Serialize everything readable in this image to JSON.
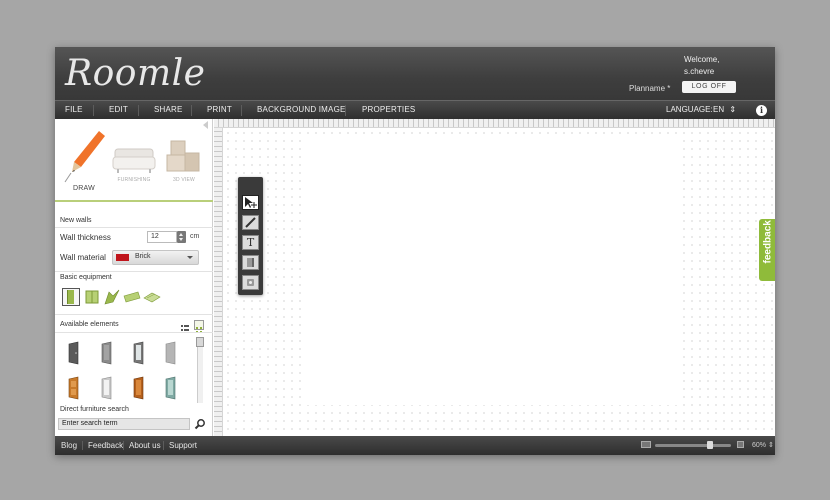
{
  "header": {
    "logo": "Roomle",
    "welcome": "Welcome,",
    "username": "s.chevre",
    "planname_label": "Planname *",
    "logoff_label": "LOG OFF"
  },
  "menu": {
    "items": [
      {
        "label": "FILE"
      },
      {
        "label": "EDIT"
      },
      {
        "label": "SHARE"
      },
      {
        "label": "PRINT"
      },
      {
        "label": "BACKGROUND IMAGE"
      },
      {
        "label": "PROPERTIES"
      }
    ],
    "language_label": "LANGUAGE:",
    "language_value": "EN",
    "info_icon": "i"
  },
  "panel": {
    "tabs": [
      {
        "label": "DRAW",
        "icon": "pencil-icon",
        "active": true
      },
      {
        "label": "FURNISHING",
        "icon": "sofa-icon",
        "active": false
      },
      {
        "label": "3D VIEW",
        "icon": "boxes-icon",
        "active": false
      }
    ],
    "new_walls_title": "New walls",
    "wall_thickness_label": "Wall thickness",
    "wall_thickness_value": "12",
    "wall_thickness_unit": "cm",
    "wall_material_label": "Wall material",
    "wall_material_value": "Brick",
    "wall_material_color": "#c0141b",
    "basic_equipment_title": "Basic equipment",
    "basic_equipment": [
      "door-icon",
      "window-icon",
      "stairs-icon",
      "floor-icon",
      "ramp-icon"
    ],
    "available_elements_title": "Available elements",
    "view_modes": [
      "list-view-icon",
      "grid-view-icon"
    ],
    "elements": [
      {
        "icon": "door-dark-icon",
        "color": "#5a5a5a"
      },
      {
        "icon": "door-grey-icon",
        "color": "#8a8a8a"
      },
      {
        "icon": "door-glass-icon",
        "color": "#777"
      },
      {
        "icon": "door-light-icon",
        "color": "#b5b5b5"
      },
      {
        "icon": "door-wood-icon",
        "color": "#c87a2a"
      },
      {
        "icon": "door-white-icon",
        "color": "#c9c9c9"
      },
      {
        "icon": "door-wood-panel-icon",
        "color": "#b5601c"
      },
      {
        "icon": "door-teal-icon",
        "color": "#7fa9a3"
      }
    ],
    "search_title": "Direct furniture search",
    "search_placeholder": "Enter search term"
  },
  "toolbar": {
    "tools": [
      {
        "icon": "select-move-icon",
        "selected": true
      },
      {
        "icon": "pencil-tool-icon",
        "selected": false
      },
      {
        "icon": "text-tool-icon",
        "selected": false,
        "glyph": "T"
      },
      {
        "icon": "wall-tool-icon",
        "selected": false
      },
      {
        "icon": "eraser-tool-icon",
        "selected": false
      }
    ]
  },
  "feedback": {
    "label": "feedback",
    "color": "#8fbb3a"
  },
  "footer": {
    "links": [
      {
        "label": "Blog"
      },
      {
        "label": "Feedback"
      },
      {
        "label": "About us"
      },
      {
        "label": "Support"
      }
    ],
    "zoom_value": "60%",
    "zoom_level": 0.72
  }
}
